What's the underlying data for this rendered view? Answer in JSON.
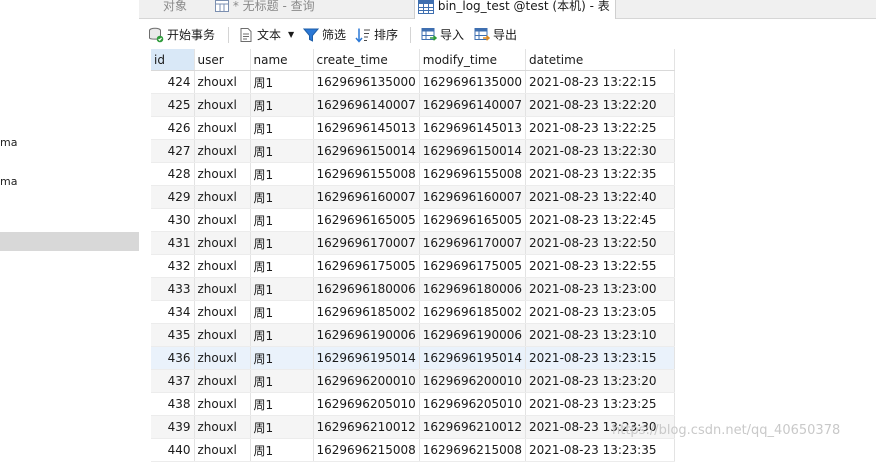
{
  "left_panel": {
    "items": [
      "ma",
      "ma"
    ]
  },
  "tabs": [
    {
      "label": "对象"
    },
    {
      "label": "* 无标题 - 查询"
    },
    {
      "label": "bin_log_test @test (本机) - 表"
    }
  ],
  "toolbar": {
    "begin_transaction": "开始事务",
    "text": "文本",
    "filter": "筛选",
    "sort": "排序",
    "import": "导入",
    "export": "导出"
  },
  "grid": {
    "columns": [
      "id",
      "user",
      "name",
      "create_time",
      "modify_time",
      "datetime"
    ],
    "rows": [
      [
        "424",
        "zhouxl",
        "周1",
        "1629696135000",
        "1629696135000",
        "2021-08-23 13:22:15"
      ],
      [
        "425",
        "zhouxl",
        "周1",
        "1629696140007",
        "1629696140007",
        "2021-08-23 13:22:20"
      ],
      [
        "426",
        "zhouxl",
        "周1",
        "1629696145013",
        "1629696145013",
        "2021-08-23 13:22:25"
      ],
      [
        "427",
        "zhouxl",
        "周1",
        "1629696150014",
        "1629696150014",
        "2021-08-23 13:22:30"
      ],
      [
        "428",
        "zhouxl",
        "周1",
        "1629696155008",
        "1629696155008",
        "2021-08-23 13:22:35"
      ],
      [
        "429",
        "zhouxl",
        "周1",
        "1629696160007",
        "1629696160007",
        "2021-08-23 13:22:40"
      ],
      [
        "430",
        "zhouxl",
        "周1",
        "1629696165005",
        "1629696165005",
        "2021-08-23 13:22:45"
      ],
      [
        "431",
        "zhouxl",
        "周1",
        "1629696170007",
        "1629696170007",
        "2021-08-23 13:22:50"
      ],
      [
        "432",
        "zhouxl",
        "周1",
        "1629696175005",
        "1629696175005",
        "2021-08-23 13:22:55"
      ],
      [
        "433",
        "zhouxl",
        "周1",
        "1629696180006",
        "1629696180006",
        "2021-08-23 13:23:00"
      ],
      [
        "434",
        "zhouxl",
        "周1",
        "1629696185002",
        "1629696185002",
        "2021-08-23 13:23:05"
      ],
      [
        "435",
        "zhouxl",
        "周1",
        "1629696190006",
        "1629696190006",
        "2021-08-23 13:23:10"
      ],
      [
        "436",
        "zhouxl",
        "周1",
        "1629696195014",
        "1629696195014",
        "2021-08-23 13:23:15"
      ],
      [
        "437",
        "zhouxl",
        "周1",
        "1629696200010",
        "1629696200010",
        "2021-08-23 13:23:20"
      ],
      [
        "438",
        "zhouxl",
        "周1",
        "1629696205010",
        "1629696205010",
        "2021-08-23 13:23:25"
      ],
      [
        "439",
        "zhouxl",
        "周1",
        "1629696210012",
        "1629696210012",
        "2021-08-23 13:23:30"
      ],
      [
        "440",
        "zhouxl",
        "周1",
        "1629696215008",
        "1629696215008",
        "2021-08-23 13:23:35"
      ]
    ]
  },
  "watermark": "https://blog.csdn.net/qq_40650378",
  "icons": {
    "table_tab": "table-icon",
    "query_tab": "query-icon",
    "begin_transaction": "transaction-icon",
    "text": "text-document-icon",
    "filter": "filter-funnel-icon",
    "sort": "sort-icon",
    "import": "import-icon",
    "export": "export-icon"
  },
  "colors": {
    "selected_header": "#d9e8f7",
    "alt_row": "#f5f5f5",
    "accent_blue": "#2b78d6"
  }
}
